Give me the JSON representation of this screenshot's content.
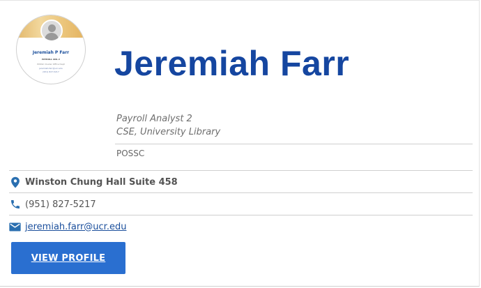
{
  "person": {
    "name": "Jeremiah Farr",
    "title": "Payroll Analyst 2",
    "department": "CSE, University Library",
    "organization": "POSSC"
  },
  "avatar": {
    "name": "Jeremiah P Farr",
    "line1": "PAYROLL ANL 2",
    "line2": "POSSC Cluster Office Dept",
    "line3": "jeremiah.farr@ucr.edu",
    "line4": "(951) 827-5217"
  },
  "contact": {
    "location": "Winston Chung Hall Suite 458",
    "phone": "(951) 827-5217",
    "email": "jeremiah.farr@ucr.edu"
  },
  "actions": {
    "view_profile_label": "VIEW PROFILE"
  },
  "colors": {
    "name": "#1546a0",
    "button": "#2a6fd0",
    "icon": "#2a6fb0",
    "link": "#1b4f9c"
  },
  "icons": {
    "location": "map-pin-icon",
    "phone": "phone-icon",
    "email": "envelope-icon"
  }
}
